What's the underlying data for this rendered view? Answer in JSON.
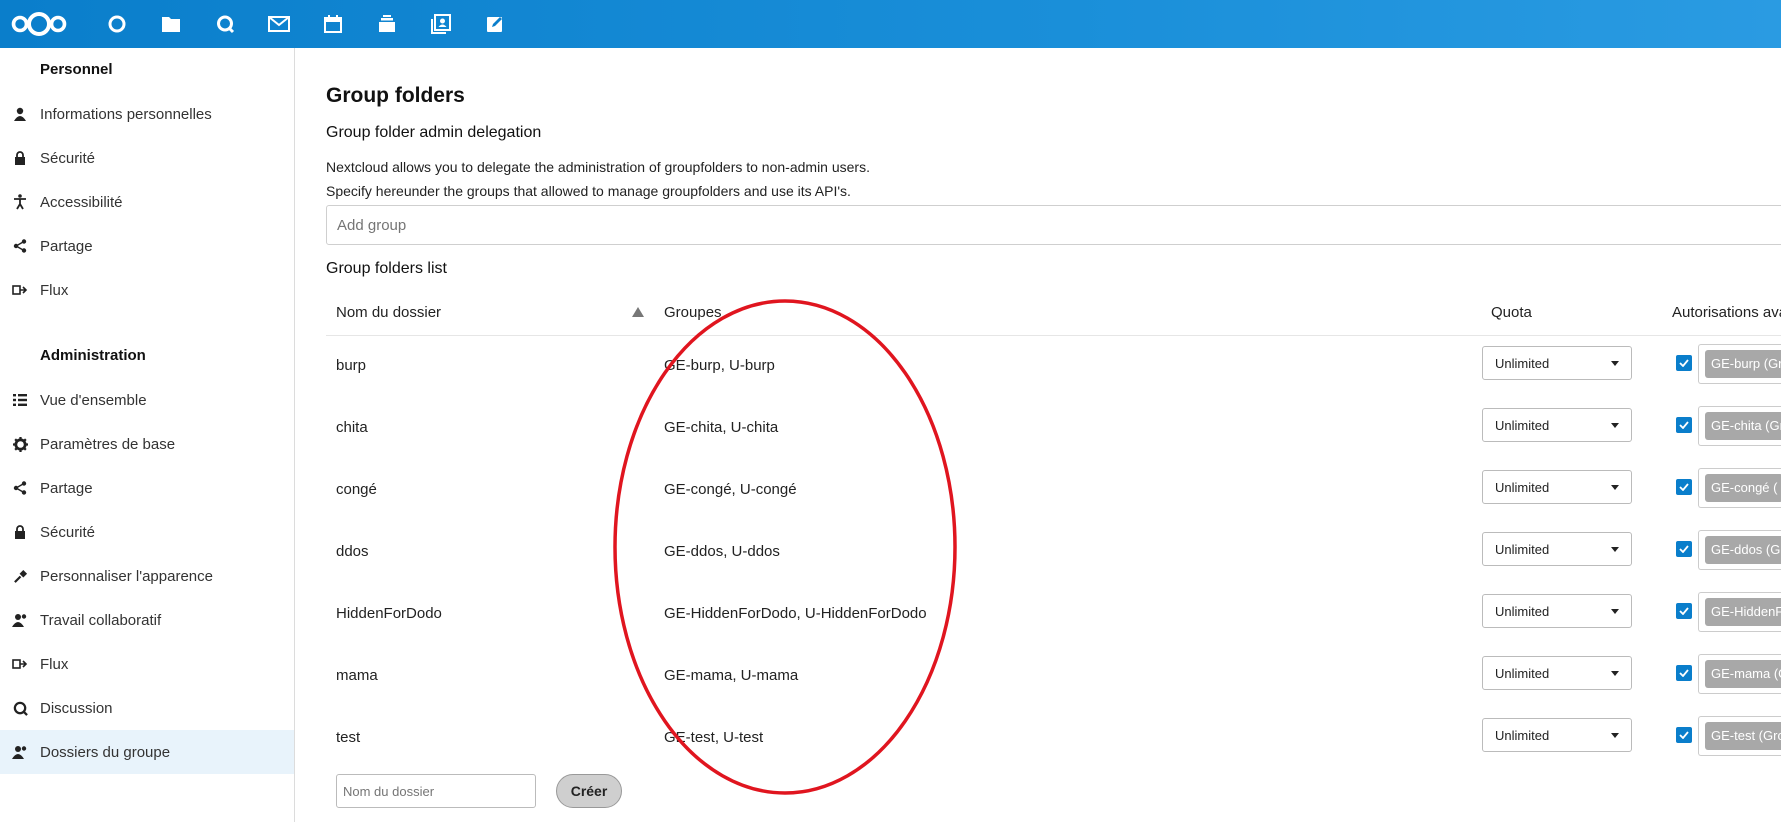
{
  "topbar": {
    "apps": [
      {
        "name": "dashboard-icon"
      },
      {
        "name": "files-icon"
      },
      {
        "name": "talk-icon"
      },
      {
        "name": "mail-icon"
      },
      {
        "name": "calendar-icon"
      },
      {
        "name": "deck-icon"
      },
      {
        "name": "contacts-icon"
      },
      {
        "name": "notes-icon"
      }
    ],
    "accent": "#0a7ecb"
  },
  "sidebar": {
    "personal_heading": "Personnel",
    "personal_items": [
      {
        "label": "Informations personnelles",
        "icon": "user-icon"
      },
      {
        "label": "Sécurité",
        "icon": "lock-icon"
      },
      {
        "label": "Accessibilité",
        "icon": "accessibility-icon"
      },
      {
        "label": "Partage",
        "icon": "share-icon"
      },
      {
        "label": "Flux",
        "icon": "activity-icon"
      }
    ],
    "admin_heading": "Administration",
    "admin_items": [
      {
        "label": "Vue d'ensemble",
        "icon": "list-icon"
      },
      {
        "label": "Paramètres de base",
        "icon": "gear-icon"
      },
      {
        "label": "Partage",
        "icon": "share-icon"
      },
      {
        "label": "Sécurité",
        "icon": "lock-icon"
      },
      {
        "label": "Personnaliser l'apparence",
        "icon": "theming-icon"
      },
      {
        "label": "Travail collaboratif",
        "icon": "user-group-icon"
      },
      {
        "label": "Flux",
        "icon": "activity-icon"
      },
      {
        "label": "Discussion",
        "icon": "talk-icon"
      },
      {
        "label": "Dossiers du groupe",
        "icon": "group-folder-icon",
        "active": true
      }
    ]
  },
  "main": {
    "title": "Group folders",
    "delegation_title": "Group folder admin delegation",
    "delegation_desc1": "Nextcloud allows you to delegate the administration of groupfolders to non-admin users.",
    "delegation_desc2": "Specify hereunder the groups that allowed to manage groupfolders and use its API's.",
    "add_group_placeholder": "Add group",
    "list_title": "Group folders list",
    "columns": {
      "name": "Nom du dossier",
      "groups": "Groupes",
      "quota": "Quota",
      "permissions": "Autorisations ava"
    },
    "rows": [
      {
        "name": "burp",
        "groups": "GE-burp, U-burp",
        "quota": "Unlimited",
        "perm": "GE-burp (Gr"
      },
      {
        "name": "chita",
        "groups": "GE-chita, U-chita",
        "quota": "Unlimited",
        "perm": "GE-chita (Gr"
      },
      {
        "name": "congé",
        "groups": "GE-congé, U-congé",
        "quota": "Unlimited",
        "perm": "GE-congé ("
      },
      {
        "name": "ddos",
        "groups": "GE-ddos, U-ddos",
        "quota": "Unlimited",
        "perm": "GE-ddos (G"
      },
      {
        "name": "HiddenForDodo",
        "groups": "GE-HiddenForDodo, U-HiddenForDodo",
        "quota": "Unlimited",
        "perm": "GE-HiddenF"
      },
      {
        "name": "mama",
        "groups": "GE-mama, U-mama",
        "quota": "Unlimited",
        "perm": "GE-mama (G"
      },
      {
        "name": "test",
        "groups": "GE-test, U-test",
        "quota": "Unlimited",
        "perm": "GE-test (Gro"
      }
    ],
    "new_folder_placeholder": "Nom du dossier",
    "create_label": "Créer",
    "annotation_color": "#e0151f"
  }
}
